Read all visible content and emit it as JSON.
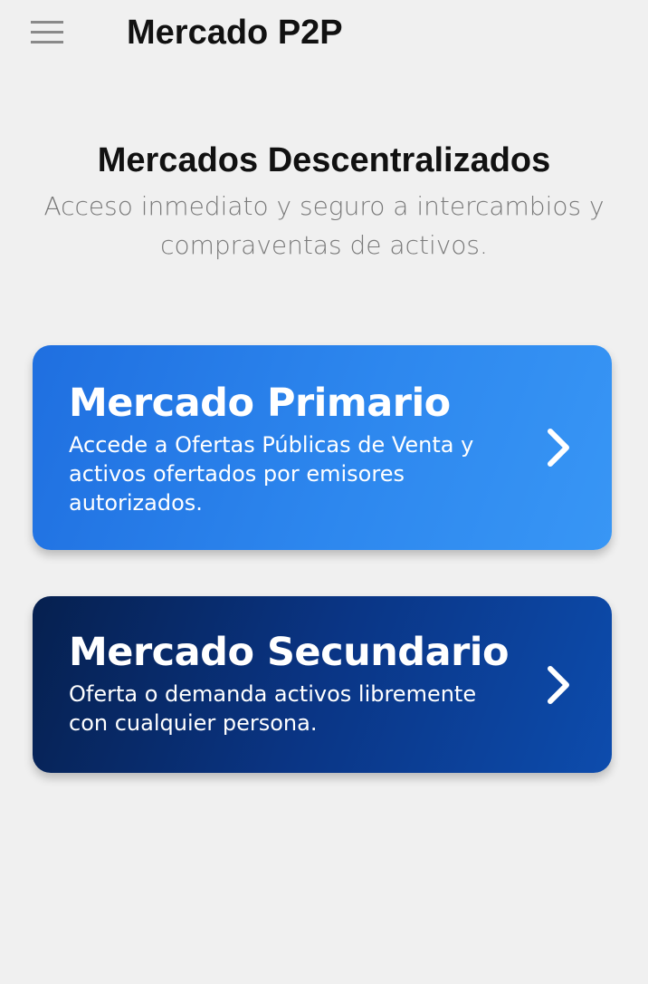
{
  "app_bar": {
    "title": "Mercado P2P",
    "menu_icon": "hamburger-menu-icon"
  },
  "hero": {
    "title": "Mercados Descentralizados",
    "subtitle": "Acceso inmediato y seguro a intercambios y compraventas de activos."
  },
  "cards": [
    {
      "title": "Mercado Primario",
      "description": "Accede a Ofertas Públicas de Venta y activos ofertados por emisores autorizados.",
      "icon": "chevron-right-icon",
      "colors": [
        "#1f6fe0",
        "#3896f5"
      ]
    },
    {
      "title": "Mercado Secundario",
      "description": "Oferta o demanda activos libremente con cualquier persona.",
      "icon": "chevron-right-icon",
      "colors": [
        "#06204f",
        "#0d4cad"
      ]
    }
  ],
  "colors": {
    "background": "#f0f0f0",
    "title_text": "#111111",
    "subtitle_text": "#7a7a7a",
    "card_text": "#ffffff"
  }
}
